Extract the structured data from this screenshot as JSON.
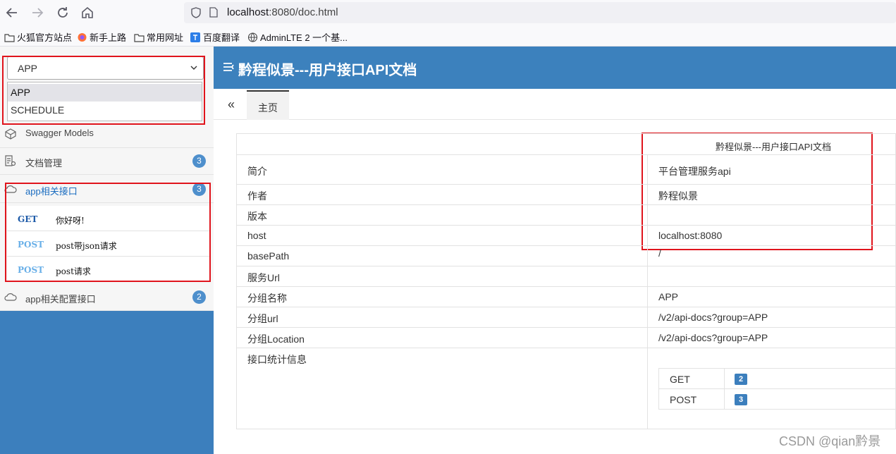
{
  "browser": {
    "url_host": "localhost",
    "url_rest": ":8080/doc.html",
    "bookmarks": [
      "火狐官方站点",
      "新手上路",
      "常用网址",
      "百度翻译",
      "AdminLTE 2 一个基..."
    ],
    "icons": [
      "back-icon",
      "forward-icon",
      "reload-icon",
      "home-icon",
      "shield-icon",
      "page-icon"
    ]
  },
  "header": {
    "title": "黔程似景---用户接口API文档"
  },
  "sidebar": {
    "group_select": {
      "value": "APP",
      "options": [
        "APP",
        "SCHEDULE"
      ]
    },
    "items": [
      {
        "label": "Swagger Models",
        "icon": "cube-icon"
      },
      {
        "label": "文档管理",
        "icon": "doc-gear-icon",
        "badge": "3"
      },
      {
        "label": "app相关接口",
        "icon": "cloud-api-icon",
        "badge": "3"
      },
      {
        "label": "app相关配置接口",
        "icon": "cloud-api-icon",
        "badge": "2"
      }
    ],
    "apis": [
      {
        "method": "GET",
        "summary": "你好呀!"
      },
      {
        "method": "POST",
        "summary": "post带json请求"
      },
      {
        "method": "POST",
        "summary": "post请求"
      }
    ]
  },
  "tabs": {
    "home": "主页",
    "collapse_glyph": "«"
  },
  "info": {
    "title": "黔程似景---用户接口API文档",
    "rows": [
      {
        "key": "简介",
        "value": "平台管理服务api"
      },
      {
        "key": "作者",
        "value": "黔程似景"
      },
      {
        "key": "版本",
        "value": ""
      },
      {
        "key": "host",
        "value": "localhost:8080"
      },
      {
        "key": "basePath",
        "value": "/"
      },
      {
        "key": "服务Url",
        "value": ""
      },
      {
        "key": "分组名称",
        "value": "APP"
      },
      {
        "key": "分组url",
        "value": "/v2/api-docs?group=APP"
      },
      {
        "key": "分组Location",
        "value": "/v2/api-docs?group=APP"
      },
      {
        "key": "接口统计信息",
        "value": ""
      }
    ],
    "stats": [
      {
        "method": "GET",
        "count": "2"
      },
      {
        "method": "POST",
        "count": "3"
      }
    ]
  },
  "watermark": "CSDN @qian黔景",
  "colors": {
    "header": "#3c81bd",
    "sidebar": "#3c7fbd",
    "highlight": "#e0141c",
    "badge": "#4e8fcc"
  }
}
